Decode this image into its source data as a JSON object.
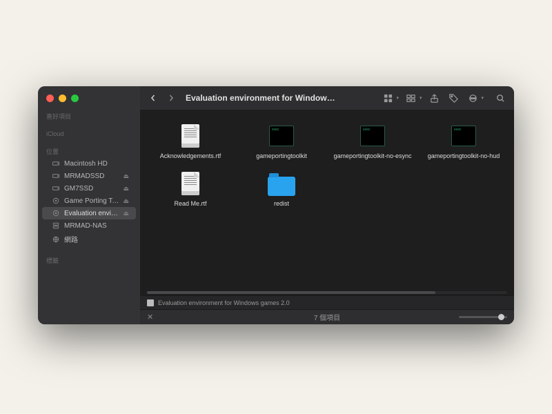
{
  "window": {
    "title": "Evaluation environment for Window…"
  },
  "sidebar": {
    "sections": {
      "favorites": "喜好項目",
      "icloud": "iCloud",
      "locations": "位置",
      "tags": "標籤"
    },
    "items": [
      {
        "label": "Macintosh HD",
        "icon": "hdd",
        "eject": false
      },
      {
        "label": "MRMADSSD",
        "icon": "hdd",
        "eject": true
      },
      {
        "label": "GM7SSD",
        "icon": "hdd",
        "eject": true
      },
      {
        "label": "Game Porting Tool…",
        "icon": "disk",
        "eject": true
      },
      {
        "label": "Evaluation environ…",
        "icon": "disk",
        "eject": true,
        "selected": true
      },
      {
        "label": "MRMAD-NAS",
        "icon": "server",
        "eject": false
      },
      {
        "label": "網路",
        "icon": "globe",
        "eject": false
      }
    ]
  },
  "files": [
    {
      "name": "Acknowledgements.rtf",
      "type": "rtf"
    },
    {
      "name": "gameportingtoolkit",
      "type": "exec"
    },
    {
      "name": "gameportingtoolkit-no-esync",
      "type": "exec"
    },
    {
      "name": "gameportingtoolkit-no-hud",
      "type": "exec"
    },
    {
      "name": "Read Me.rtf",
      "type": "rtf"
    },
    {
      "name": "redist",
      "type": "folder"
    }
  ],
  "pathbar": {
    "text": "Evaluation environment for Windows games 2.0"
  },
  "statusbar": {
    "text": "7 個項目"
  }
}
